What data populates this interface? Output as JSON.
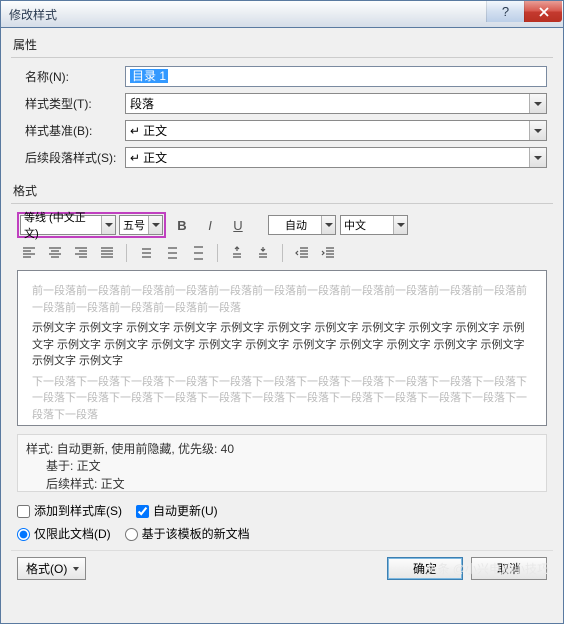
{
  "title": "修改样式",
  "sections": {
    "props": "属性",
    "format": "格式"
  },
  "fields": {
    "name_label": "名称(N):",
    "name_value": "目录 1",
    "type_label": "样式类型(T):",
    "type_value": "段落",
    "based_label": "样式基准(B):",
    "based_value": "正文",
    "next_label": "后续段落样式(S):",
    "next_value": "正文"
  },
  "format_toolbar": {
    "font_name": "等线 (中文正文)",
    "font_size": "五号",
    "color": "自动",
    "lang": "中文"
  },
  "preview": {
    "ghost_before": "前一段落前一段落前一段落前一段落前一段落前一段落前一段落前一段落前一段落前一段落前一段落前一段落前一段落前一段落前一段落前一段落",
    "sample": "示例文字 示例文字 示例文字 示例文字 示例文字 示例文字 示例文字 示例文字 示例文字 示例文字 示例文字 示例文字 示例文字 示例文字 示例文字 示例文字 示例文字 示例文字 示例文字 示例文字 示例文字 示例文字 示例文字",
    "ghost_after": "下一段落下一段落下一段落下一段落下一段落下一段落下一段落下一段落下一段落下一段落下一段落下一段落下一段落下一段落下一段落下一段落下一段落下一段落下一段落下一段落下一段落下一段落下一段落下一段落"
  },
  "description": {
    "line1": "样式: 自动更新, 使用前隐藏, 优先级: 40",
    "line2": "基于: 正文",
    "line3": "后续样式: 正文"
  },
  "options": {
    "add_to_gallery": "添加到样式库(S)",
    "auto_update": "自动更新(U)",
    "this_doc": "仅限此文档(D)",
    "template": "基于该模板的新文档"
  },
  "buttons": {
    "format": "格式(O)",
    "ok": "确定",
    "cancel": "取消"
  },
  "watermark": "头条 @小兴电脑小技巧"
}
